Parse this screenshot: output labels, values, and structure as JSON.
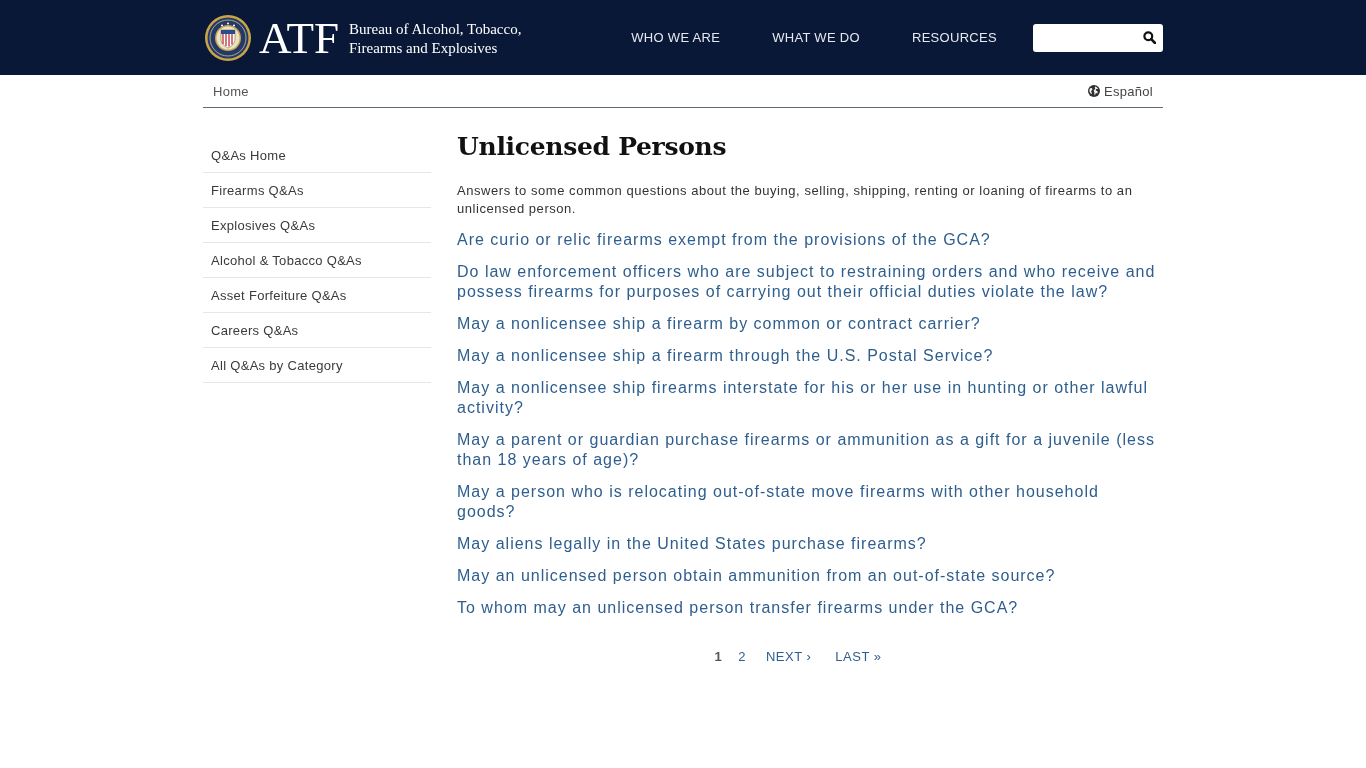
{
  "header": {
    "logo_text": "ATF",
    "agency_name": "Bureau of Alcohol, Tobacco, Firearms and Explosives",
    "nav": [
      "WHO WE ARE",
      "WHAT WE DO",
      "RESOURCES"
    ]
  },
  "breadcrumb": [
    "Home"
  ],
  "language_link": "Español",
  "sidebar": {
    "items": [
      "Q&As Home",
      "Firearms Q&As",
      "Explosives Q&As",
      "Alcohol & Tobacco Q&As",
      "Asset Forfeiture Q&As",
      "Careers Q&As",
      "All Q&As by Category"
    ]
  },
  "main": {
    "title": "Unlicensed Persons",
    "intro": "Answers to some common questions about the buying, selling, shipping, renting or loaning of firearms to an unlicensed person.",
    "questions": [
      "Are curio or relic firearms exempt from the provisions of the GCA?",
      "Do law enforcement officers who are subject to restraining orders and who receive and possess firearms for purposes of carrying out their official duties violate the law?",
      "May a nonlicensee ship a firearm by common or contract carrier?",
      "May a nonlicensee ship a firearm through the U.S. Postal Service?",
      "May a nonlicensee ship firearms interstate for his or her use in hunting or other lawful activity?",
      "May a parent or guardian purchase firearms or ammunition as a gift for a juvenile (less than 18 years of age)?",
      "May a person who is relocating out-of-state move firearms with other household goods?",
      "May aliens legally in the United States purchase firearms?",
      "May an unlicensed person obtain ammunition from an out-of-state source?",
      "To whom may an unlicensed person transfer firearms under the GCA?"
    ]
  },
  "pagination": [
    {
      "kind": "page",
      "label": "1",
      "selected": true
    },
    {
      "kind": "page",
      "label": "2",
      "selected": false
    },
    {
      "kind": "step",
      "label": "NEXT ›",
      "selected": false
    },
    {
      "kind": "step",
      "label": "LAST »",
      "selected": false
    }
  ]
}
